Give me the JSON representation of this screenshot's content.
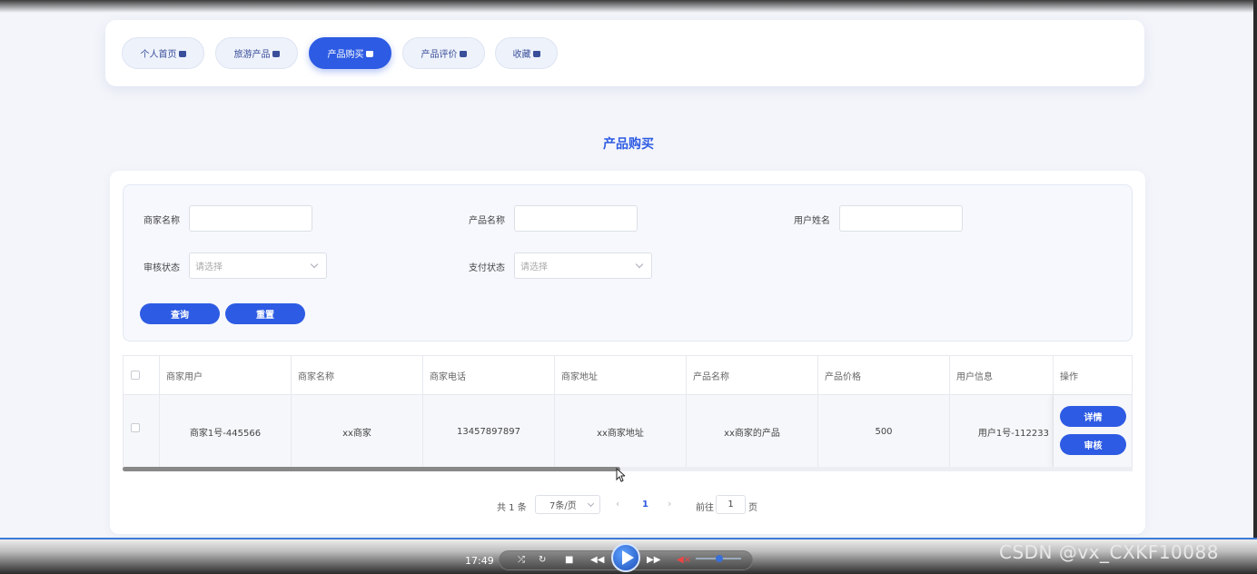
{
  "nav": {
    "tabs": [
      {
        "label": "个人首页",
        "active": false
      },
      {
        "label": "旅游产品",
        "active": false
      },
      {
        "label": "产品购买",
        "active": true
      },
      {
        "label": "产品评价",
        "active": false
      },
      {
        "label": "收藏",
        "active": false
      }
    ]
  },
  "page": {
    "title": "产品购买"
  },
  "search": {
    "merchant_name_label": "商家名称",
    "product_name_label": "产品名称",
    "user_name_label": "用户姓名",
    "review_status_label": "审核状态",
    "review_status_placeholder": "请选择",
    "pay_status_label": "支付状态",
    "pay_status_placeholder": "请选择",
    "query_button": "查询",
    "reset_button": "重置"
  },
  "table": {
    "headers": [
      "商家用户",
      "商家名称",
      "商家电话",
      "商家地址",
      "产品名称",
      "产品价格",
      "用户信息",
      "操作"
    ],
    "rows": [
      {
        "merchant_user": "商家1号-445566",
        "merchant_name": "xx商家",
        "merchant_phone": "13457897897",
        "merchant_address": "xx商家地址",
        "product_name": "xx商家的产品",
        "product_price": "500",
        "user_info": "用户1号-112233",
        "detail_button": "详情",
        "review_button": "审核"
      }
    ]
  },
  "pagination": {
    "total_text": "共 1 条",
    "page_size": "7条/页",
    "current_page": "1",
    "goto_label": "前往",
    "goto_value": "1",
    "page_suffix": "页"
  },
  "player": {
    "time": "17:49",
    "watermark": "CSDN @vx_CXKF10088"
  },
  "colors": {
    "accent": "#2d5be3",
    "background": "#f3f5fa"
  }
}
